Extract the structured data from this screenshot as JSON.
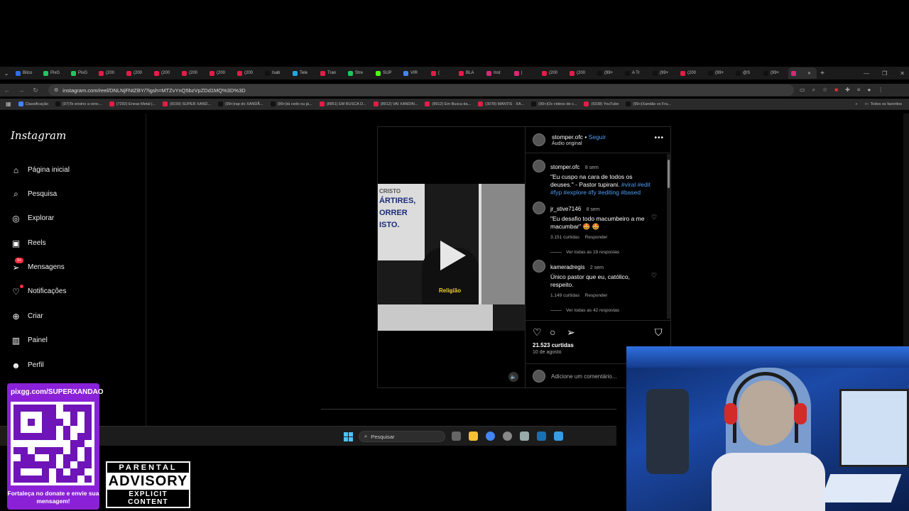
{
  "browser": {
    "tabs": [
      {
        "label": "Bitco",
        "color": "#2f6fe0"
      },
      {
        "label": "PixG",
        "color": "#22c55e"
      },
      {
        "label": "PixG",
        "color": "#22c55e"
      },
      {
        "label": "(200",
        "color": "#e11d48"
      },
      {
        "label": "(200",
        "color": "#e11d48"
      },
      {
        "label": "(200",
        "color": "#e11d48"
      },
      {
        "label": "(200",
        "color": "#e11d48"
      },
      {
        "label": "(200",
        "color": "#e11d48"
      },
      {
        "label": "(200",
        "color": "#e11d48"
      },
      {
        "label": "Isab",
        "color": "#111111"
      },
      {
        "label": "Tele",
        "color": "#2aa3e0"
      },
      {
        "label": "Tran",
        "color": "#e11d48"
      },
      {
        "label": "Stre",
        "color": "#22c55e"
      },
      {
        "label": "SUP",
        "color": "#53fc18"
      },
      {
        "label": "VIR",
        "color": "#4285f4"
      },
      {
        "label": "(",
        "color": "#e11d48"
      },
      {
        "label": "BLA",
        "color": "#e11d48"
      },
      {
        "label": "Inst",
        "color": "#d62976"
      },
      {
        "label": "|",
        "color": "#d62976"
      },
      {
        "label": "(200",
        "color": "#e11d48"
      },
      {
        "label": "(200",
        "color": "#e11d48"
      },
      {
        "label": "(99+",
        "color": "#111111"
      },
      {
        "label": "A Tr",
        "color": "#111111"
      },
      {
        "label": "(99+",
        "color": "#111111"
      },
      {
        "label": "(200",
        "color": "#e11d48"
      },
      {
        "label": "(99+",
        "color": "#111111"
      },
      {
        "label": "@S",
        "color": "#111111"
      },
      {
        "label": "(99+",
        "color": "#111111"
      },
      {
        "label": "",
        "color": "#d62976"
      }
    ],
    "new_tab": "+",
    "url": "instagram.com/reel/DNLNjFNtZBY/?igsh=MTZvYnQ5bzVpZDd1MQ%3D%3D",
    "bookmarks": [
      {
        "label": "Classificação",
        "color": "#4285f4"
      },
      {
        "label": "(97)Te ensino a venc...",
        "color": "#111111"
      },
      {
        "label": "(7292) Eneas Metal |...",
        "color": "#e11d48"
      },
      {
        "label": "(8159) SUPER XAND...",
        "color": "#e11d48"
      },
      {
        "label": "(99+)rap do XANDÃ...",
        "color": "#111111"
      },
      {
        "label": "(99+)tá cedo ou já...",
        "color": "#111111"
      },
      {
        "label": "(8851) EM BUSCA D...",
        "color": "#e11d48"
      },
      {
        "label": "(8912) VAI XANDIN...",
        "color": "#e11d48"
      },
      {
        "label": "(8912) Em Busca da...",
        "color": "#e11d48"
      },
      {
        "label": "(3078) MANTIS · XA...",
        "color": "#e11d48"
      },
      {
        "label": "(99+)Os vídeos de c...",
        "color": "#111111"
      },
      {
        "label": "(9338) YouTube",
        "color": "#e11d48"
      },
      {
        "label": "(99+)Xandão vs Fra...",
        "color": "#111111"
      }
    ],
    "all_bookmarks": "Todos os favoritos"
  },
  "instagram": {
    "logo": "Instagram",
    "nav": [
      {
        "label": "Página inicial",
        "icon": "⌂",
        "name": "home"
      },
      {
        "label": "Pesquisa",
        "icon": "⌕",
        "name": "search"
      },
      {
        "label": "Explorar",
        "icon": "◎",
        "name": "explore"
      },
      {
        "label": "Reels",
        "icon": "▣",
        "name": "reels"
      },
      {
        "label": "Mensagens",
        "icon": "➢",
        "name": "messages",
        "badge": "9+"
      },
      {
        "label": "Notificações",
        "icon": "♡",
        "name": "notifications"
      },
      {
        "label": "Criar",
        "icon": "⊕",
        "name": "create"
      },
      {
        "label": "Painel",
        "icon": "▥",
        "name": "dashboard"
      },
      {
        "label": "Perfil",
        "icon": "☻",
        "name": "profile"
      }
    ],
    "post": {
      "username": "stomper.ofc",
      "separator": "•",
      "follow": "Seguir",
      "audio": "Áudio original",
      "video_caption": "Religião",
      "sign_text": [
        "CRISTO",
        "ÁRTIRES,",
        "ORRER",
        "ISTO."
      ],
      "caption": {
        "user": "stomper.ofc",
        "time": "8 sem",
        "text": "\"Eu cuspo na cara de todos os deuses.\" - Pastor tupirani.",
        "hashtags": "#viral #edit #fyp #explore #fy #editing #based"
      },
      "comments": [
        {
          "user": "jr_stive7146",
          "time": "8 sem",
          "text": "\"Eu desafio todo macumbeiro a me macumbar\" 🤩 🤩",
          "likes": "3.151 curtidas",
          "reply": "Responder",
          "view_replies": "Ver todas as 19 respostas"
        },
        {
          "user": "kameradregis",
          "time": "2 sem",
          "text": "Único pastor que eu, católico, respeito.",
          "likes": "1.149 curtidas",
          "reply": "Responder",
          "view_replies": "Ver todas as 42 respostas"
        }
      ],
      "likes": "21.523 curtidas",
      "date": "10 de agosto",
      "comment_placeholder": "Adicione um comentário..."
    }
  },
  "taskbar": {
    "search": "Pesquisar"
  },
  "overlays": {
    "pix_url": "pixgg.com/SUPERXANDAO",
    "pix_message": "Fortaleça no donate e envie sua mensagem!",
    "advisory": {
      "line1": "PARENTAL",
      "line2": "ADVISORY",
      "line3": "EXPLICIT CONTENT"
    }
  }
}
